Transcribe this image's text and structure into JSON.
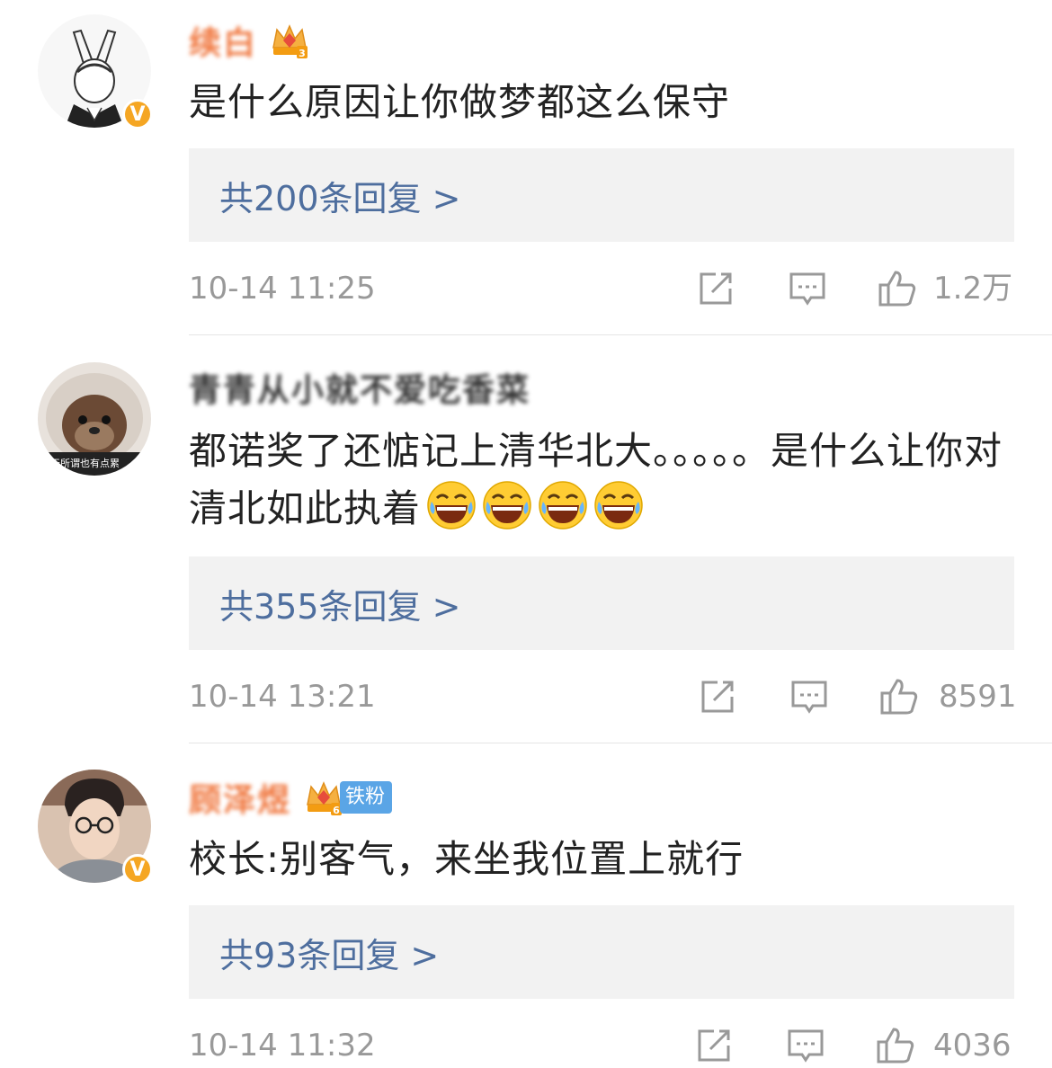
{
  "comments": [
    {
      "username": "续白",
      "verified_badge": "V",
      "text": "是什么原因让你做梦都这么保守",
      "replies_label": "共200条回复 >",
      "time": "10-14 11:25",
      "likes": "1.2万",
      "icons": [
        "avatar-fox-icon",
        "crown-level-3-icon",
        "share-icon",
        "comment-icon",
        "like-icon"
      ]
    },
    {
      "username": "青青从小就不爱吃香菜",
      "avatar_caption": "天所谓也有点累",
      "text": "都诺奖了还惦记上清华北大。。。。。是什么让你对清北如此执着",
      "emojis": [
        "laugh-cry-emoji",
        "laugh-cry-emoji",
        "laugh-cry-emoji",
        "laugh-cry-emoji"
      ],
      "replies_label": "共355条回复 >",
      "time": "10-14 13:21",
      "likes": "8591"
    },
    {
      "username": "顾泽煜",
      "verified_badge": "V",
      "fan_badge": "铁粉",
      "text": "校长:别客气，来坐我位置上就行",
      "replies_label": "共93条回复 >",
      "time": "10-14 11:32",
      "likes": "4036",
      "icons": [
        "crown-level-6-icon"
      ]
    }
  ],
  "colors": {
    "username_highlight": "#f07840",
    "reply_link": "#4e6e9e",
    "reply_bg": "#f2f2f2",
    "meta_text": "#999999",
    "verified": "#f5a623",
    "fan_badge": "#5aa5e6"
  }
}
